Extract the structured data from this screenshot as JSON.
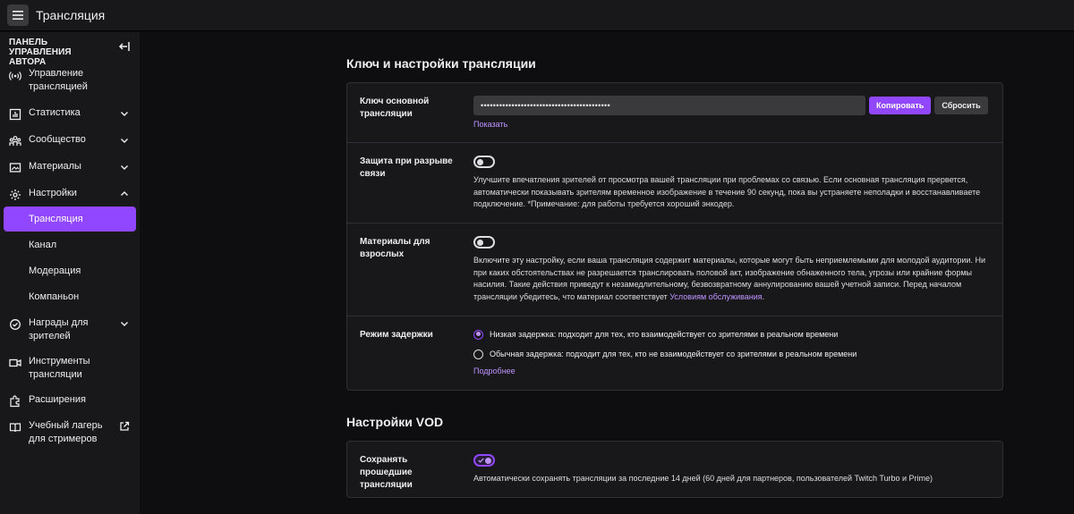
{
  "app": {
    "title": "Трансляция"
  },
  "sidebar": {
    "header": "ПАНЕЛЬ УПРАВЛЕНИЯ АВТОРА",
    "items": [
      {
        "label": "Управление трансляцией",
        "icon": "broadcast-icon"
      },
      {
        "label": "Статистика",
        "icon": "chart-icon",
        "expand": "down"
      },
      {
        "label": "Сообщество",
        "icon": "community-icon",
        "expand": "down"
      },
      {
        "label": "Материалы",
        "icon": "content-icon",
        "expand": "down"
      },
      {
        "label": "Настройки",
        "icon": "gear-icon",
        "expand": "up"
      },
      {
        "label": "Награды для зрителей",
        "icon": "rewards-icon",
        "expand": "down"
      },
      {
        "label": "Инструменты трансляции",
        "icon": "camera-icon"
      },
      {
        "label": "Расширения",
        "icon": "extensions-icon"
      },
      {
        "label": "Учебный лагерь для стримеров",
        "icon": "book-icon",
        "external": true
      }
    ],
    "settings_sub": [
      {
        "label": "Трансляция",
        "active": true
      },
      {
        "label": "Канал"
      },
      {
        "label": "Модерация"
      },
      {
        "label": "Компаньон"
      }
    ]
  },
  "main": {
    "stream_section": {
      "title": "Ключ и настройки трансляции",
      "key": {
        "label": "Ключ основной трансляции",
        "value": "••••••••••••••••••••••••••••••••••••••••••",
        "copy_label": "Копировать",
        "reset_label": "Сбросить",
        "show_label": "Показать"
      },
      "disconnect": {
        "label": "Защита при разрыве связи",
        "enabled": false,
        "description": "Улучшите впечатления зрителей от просмотра вашей трансляции при проблемах со связью. Если основная трансляция прервется, автоматически показывать зрителям временное изображение в течение 90 секунд, пока вы устраняете неполадки и восстанавливаете подключение. *Примечание: для работы требуется хороший энкодер."
      },
      "mature": {
        "label": "Материалы для взрослых",
        "enabled": false,
        "description": "Включите эту настройку, если ваша трансляция содержит материалы, которые могут быть неприемлемыми для молодой аудитории. Ни при каких обстоятельствах не разрешается транслировать половой акт, изображение обнаженного тела, угрозы или крайние формы насилия. Такие действия приведут к незамедлительному, безвозвратному аннулированию вашей учетной записи. Перед началом трансляции убедитесь, что материал соответствует ",
        "tos_link": "Условиям обслуживания",
        "tail": "."
      },
      "latency": {
        "label": "Режим задержки",
        "options": [
          {
            "label": "Низкая задержка: подходит для тех, кто взаимодействует со зрителями в реальном времени",
            "selected": true
          },
          {
            "label": "Обычная задержка: подходит для тех, кто не взаимодействует со зрителями в реальном времени",
            "selected": false
          }
        ],
        "more_label": "Подробнее"
      }
    },
    "vod_section": {
      "title": "Настройки VOD",
      "store": {
        "label": "Сохранять прошедшие трансляции",
        "enabled": true,
        "description": "Автоматически сохранять трансляции за последние 14 дней (60 дней для партнеров, пользователей Twitch Turbo и Prime)"
      }
    }
  },
  "colors": {
    "accent": "#9147ff",
    "accent_light": "#bf94ff",
    "bg": "#0e0e10",
    "panel": "#18181b"
  }
}
